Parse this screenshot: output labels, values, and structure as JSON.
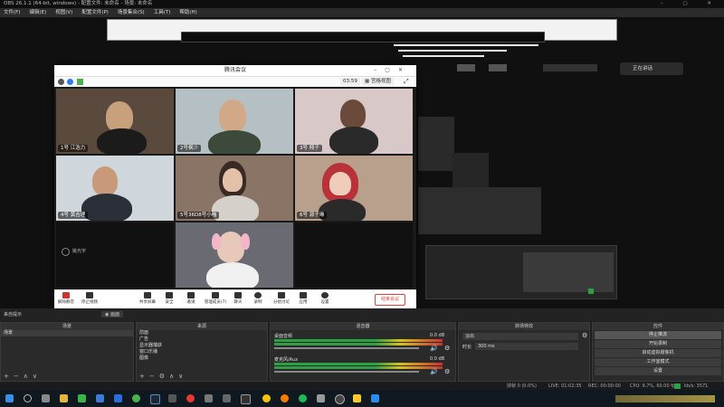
{
  "obs": {
    "title": "OBS 26.1.1 (64-bit, windows) - 配置文件: 未命名 - 场景: 未命名",
    "menu": [
      "文件(F)",
      "编辑(E)",
      "视图(V)",
      "配置文件(P)",
      "场景集合(S)",
      "工具(T)",
      "帮助(H)"
    ],
    "chat_label": "正在讲话"
  },
  "meeting": {
    "title": "腾讯会议",
    "timer": "03:59",
    "view_label": "宫格视图",
    "participants": [
      {
        "label": "1号 江浩力"
      },
      {
        "label": "2号枫少"
      },
      {
        "label": "3号 翔子"
      },
      {
        "label": "4号 黄吉理"
      },
      {
        "label": "5号36D8号小喵"
      },
      {
        "label": "6号 源子琳"
      },
      {
        "label": "姚光宇"
      },
      {
        "label": ""
      }
    ],
    "toolbar": [
      "解除静音",
      "停止视频",
      "共享屏幕",
      "安全",
      "邀请",
      "管理成员(7)",
      "聊天",
      "录制",
      "分组讨论",
      "应用",
      "设置"
    ],
    "leave_label": "结束会议"
  },
  "docks": {
    "scene_header": "场景",
    "scenes": [
      "场景"
    ],
    "sources_header": "来源",
    "sources": [
      "前面",
      "广告",
      "显示器捕获",
      "窗口乐播",
      "图像"
    ],
    "mixer_header": "混音器",
    "mixer": [
      {
        "name": "桌面音频",
        "level": "0.0 dB"
      },
      {
        "name": "麦克风/Aux",
        "level": "0.0 dB"
      }
    ],
    "transition_header": "转场特效",
    "transition_value": "淡出",
    "duration_label": "时长",
    "duration_value": "300 ms",
    "controls_header": "控件",
    "controls": [
      "停止推流",
      "开始录制",
      "启动虚拟摄像机",
      "工作室模式",
      "设置",
      "退出"
    ],
    "tabs": [
      "来自提示",
      "画面"
    ]
  },
  "status": {
    "dropped": "掉帧 0 (0.0%)",
    "live": "LIVE: 01:02:35",
    "rec": "REC: 00:00:00",
    "cpu": "CPU: 9.7%, 60.00 fps",
    "kbps": "kb/s: 3571"
  },
  "colors": {
    "obs_bg": "#1e1e1e",
    "accent_red": "#e0453a",
    "meter_green": "#2ea043"
  }
}
